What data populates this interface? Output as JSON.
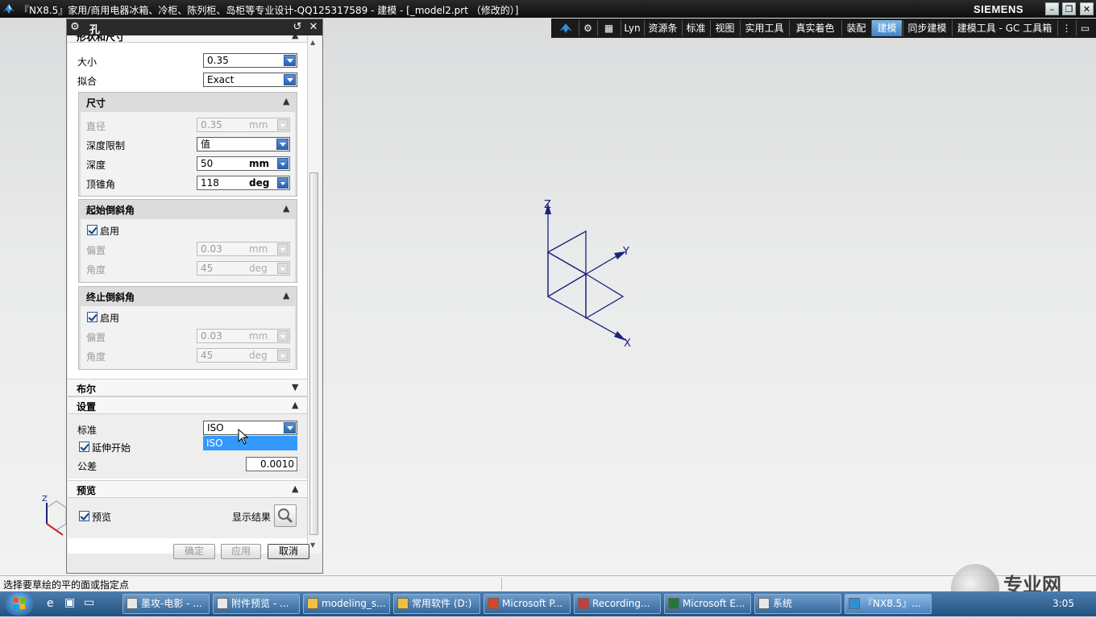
{
  "window": {
    "title": "『NX8.5』家用/商用电器冰箱、冷柜、陈列柜、岛柜等专业设计-QQ125317589 - 建模 - [_model2.prt （修改的）]",
    "brand": "SIEMENS"
  },
  "toolbar": {
    "items": [
      "Lyn",
      "资源条",
      "标准",
      "视图",
      "实用工具",
      "真实着色",
      "装配",
      "建模",
      "同步建模",
      "建模工具 - GC 工具箱"
    ],
    "active": "建模"
  },
  "dialog": {
    "title": "孔",
    "section_form": "形状和尺寸",
    "size_label": "大小",
    "size_value": "0.35",
    "fit_label": "拟合",
    "fit_value": "Exact",
    "dimensions": {
      "header": "尺寸",
      "diameter_label": "直径",
      "diameter_value": "0.35",
      "diameter_unit": "mm",
      "depth_limit_label": "深度限制",
      "depth_limit_value": "值",
      "depth_label": "深度",
      "depth_value": "50",
      "depth_unit": "mm",
      "tip_angle_label": "顶锥角",
      "tip_angle_value": "118",
      "tip_angle_unit": "deg"
    },
    "start_chamfer": {
      "header": "起始倒斜角",
      "enable_label": "启用",
      "offset_label": "偏置",
      "offset_value": "0.03",
      "offset_unit": "mm",
      "angle_label": "角度",
      "angle_value": "45",
      "angle_unit": "deg"
    },
    "end_chamfer": {
      "header": "终止倒斜角",
      "enable_label": "启用",
      "offset_label": "偏置",
      "offset_value": "0.03",
      "offset_unit": "mm",
      "angle_label": "角度",
      "angle_value": "45",
      "angle_unit": "deg"
    },
    "boolean_header": "布尔",
    "settings": {
      "header": "设置",
      "standard_label": "标准",
      "standard_value": "ISO",
      "dropdown_option": "ISO",
      "extend_start_label": "延伸开始",
      "tolerance_label": "公差",
      "tolerance_value": "0.0010"
    },
    "preview": {
      "header": "预览",
      "preview_label": "预览",
      "show_result_label": "显示结果"
    },
    "buttons": {
      "ok": "确定",
      "apply": "应用",
      "cancel": "取消"
    }
  },
  "viewport": {
    "axis_x": "X",
    "axis_y": "Y",
    "axis_z": "Z",
    "triad_z": "Z"
  },
  "status": {
    "prompt": "选择要草绘的平的面或指定点"
  },
  "taskbar": {
    "items": [
      "墨攻-电影 - ...",
      "附件预览 - ...",
      "modeling_s...",
      "常用软件 (D:)",
      "Microsoft P...",
      "Recording...",
      "Microsoft E...",
      "系统",
      "『NX8.5』..."
    ],
    "clock": "3:05",
    "watermark": "专业网"
  }
}
